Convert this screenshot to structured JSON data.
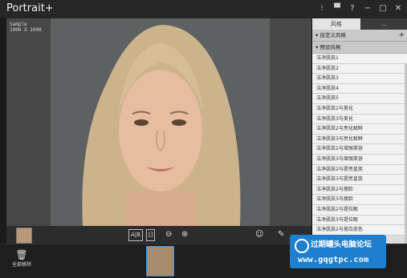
{
  "app": {
    "title": "Portrait+",
    "window_controls": [
      "⁝",
      "▀",
      "?",
      "−",
      "□",
      "✕"
    ]
  },
  "canvas": {
    "sample_label": "Sample",
    "sample_meta": "1000 X 1000"
  },
  "image_toolbar": {
    "compare_label": "A|B",
    "split_label": "[]",
    "zoom_out_icon": "zoom-out",
    "zoom_in_icon": "zoom-in"
  },
  "panel": {
    "tabs": [
      "风格",
      "..."
    ],
    "custom_section": "自定义风格",
    "preset_section": "预设风格",
    "items": [
      "洁净肌肤1",
      "洁净肌肤2",
      "洁净肌肤3",
      "洁净肌肤4",
      "洁净肌肤5",
      "洁净肌肤2与美化",
      "洁净肌肤3与美化",
      "洁净肌肤2与亮化赋鲜",
      "洁净肌肤3与亮化赋鲜",
      "洁净肌肤2与增强笑容",
      "洁净肌肤3与增强笑容",
      "洁净肌肤2与提亮皇族",
      "洁净肌肤3与提亮皇族",
      "洁净肌肤2与瘦脸",
      "洁净肌肤3与瘦脸",
      "洁净肌肤2与提拉眼",
      "洁净肌肤3与提拉眼",
      "洁净肌肤2与美白皮色"
    ]
  },
  "filmstrip": {
    "remove_all": "全部移除"
  },
  "watermark": {
    "name": "过期罐头电脑论坛",
    "url": "www.gqgtpc.com"
  }
}
